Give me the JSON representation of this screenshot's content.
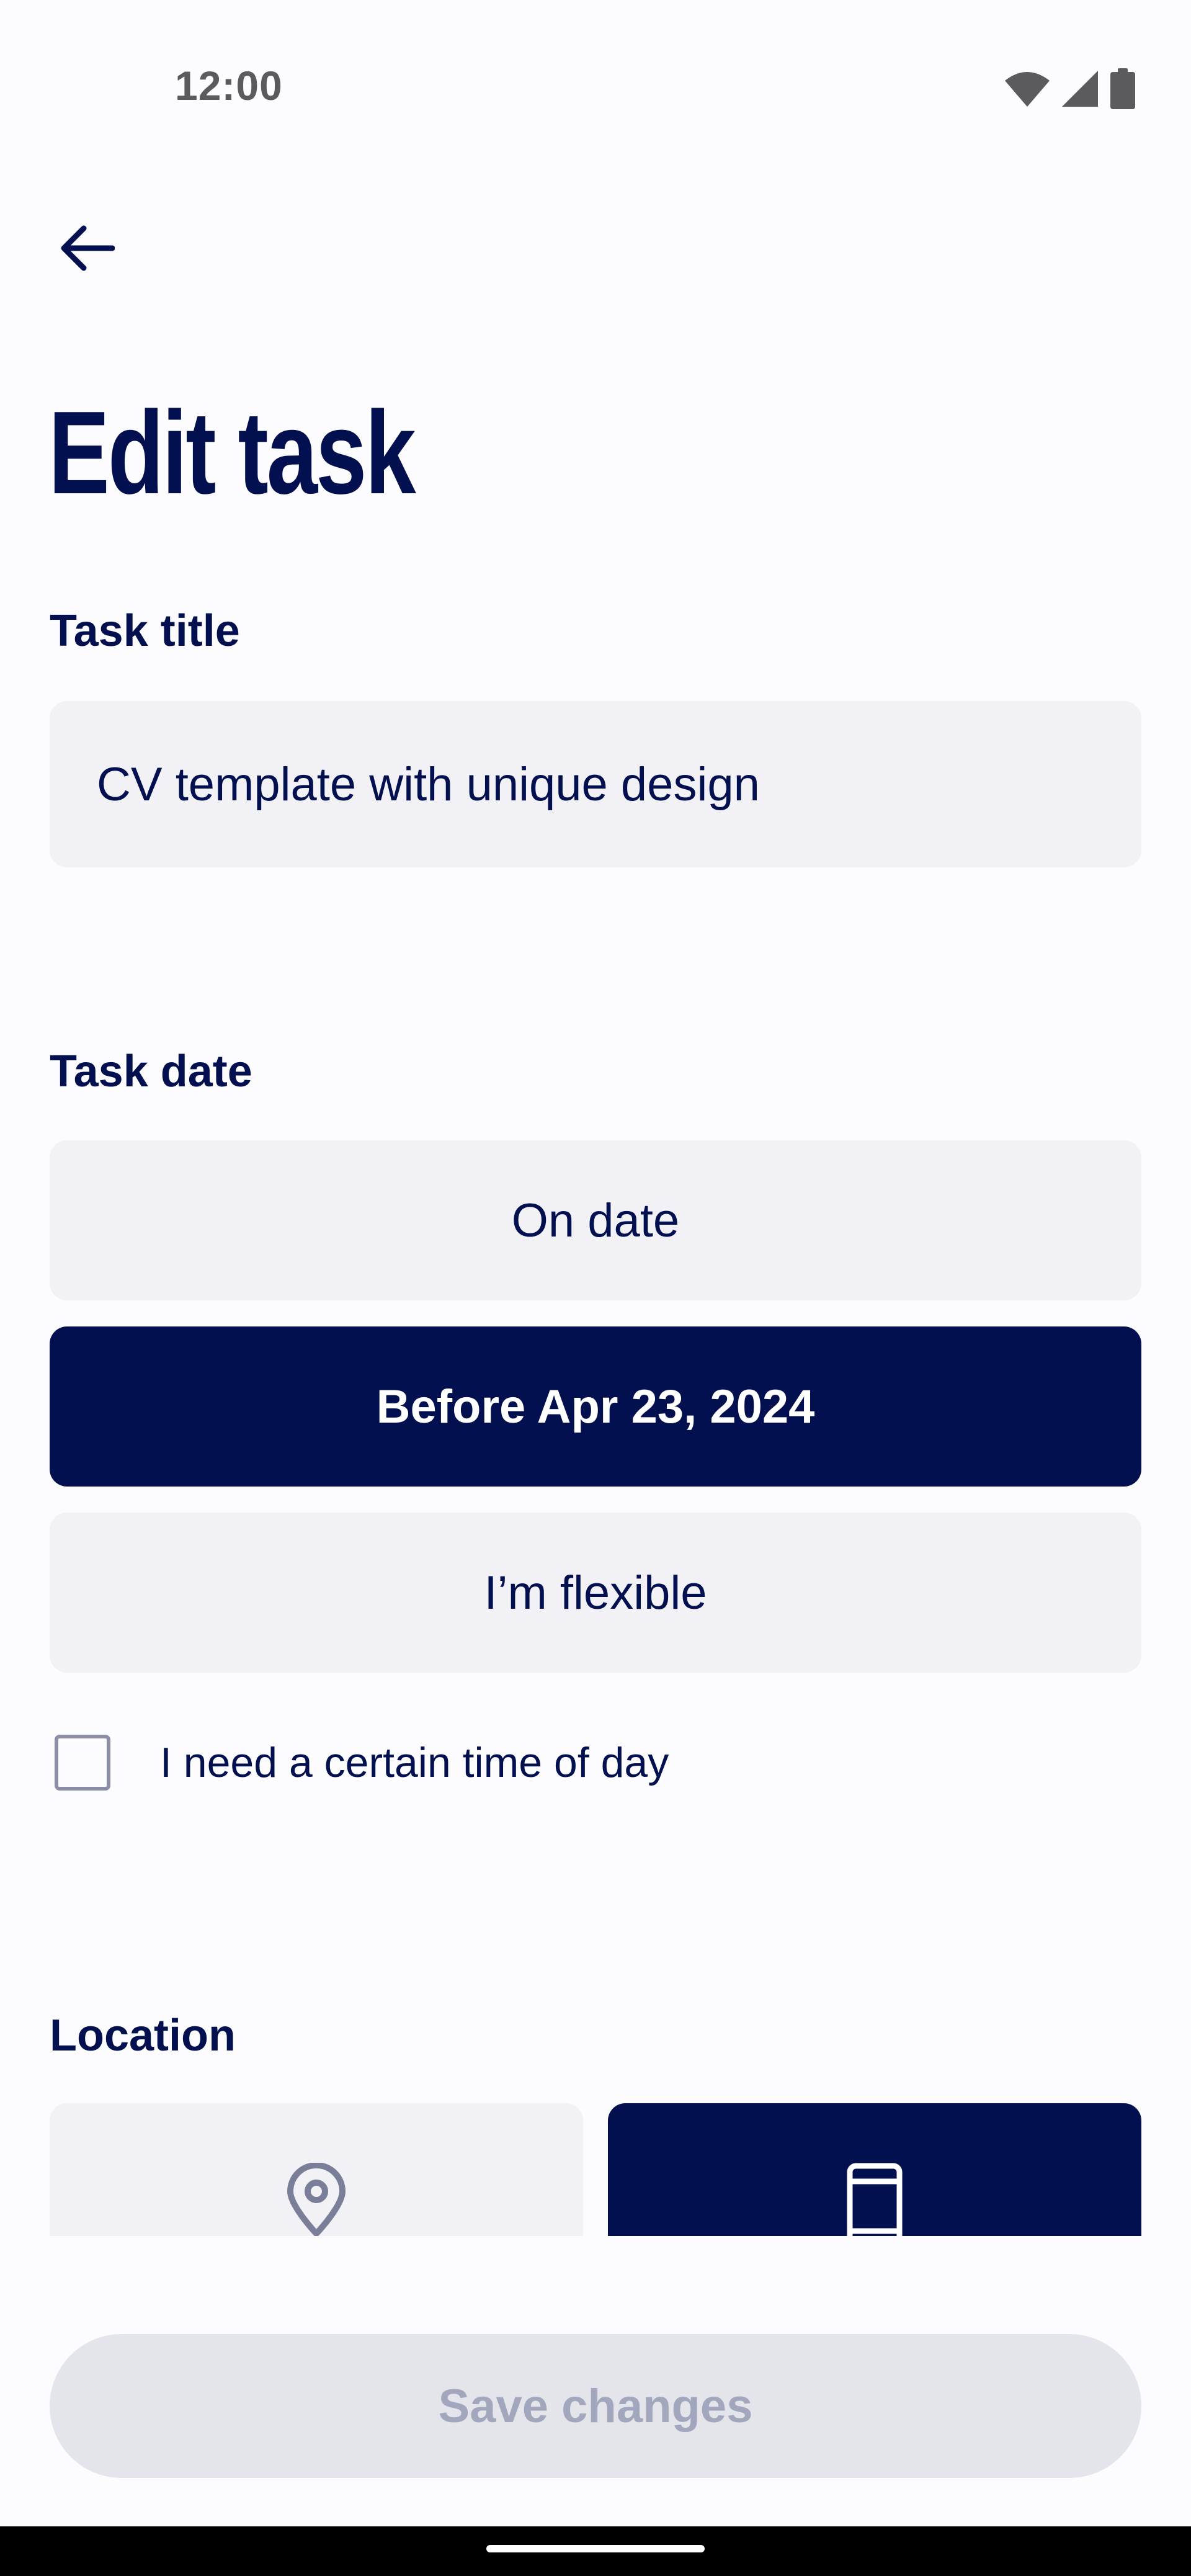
{
  "status_bar": {
    "time": "12:00",
    "icons": [
      "wifi-icon",
      "cell-signal-icon",
      "battery-icon"
    ]
  },
  "header": {
    "back_icon": "arrow-left-icon",
    "title": "Edit task"
  },
  "task_title": {
    "label": "Task title",
    "value": "CV template with unique design"
  },
  "task_date": {
    "label": "Task date",
    "options": [
      {
        "label": "On date",
        "selected": false
      },
      {
        "label": "Before Apr 23, 2024",
        "selected": true
      },
      {
        "label": "I’m flexible",
        "selected": false
      }
    ],
    "time_checkbox": {
      "label": "I need a certain time of day",
      "checked": false
    }
  },
  "location": {
    "label": "Location",
    "options": [
      {
        "icon": "map-pin-icon",
        "selected": false
      },
      {
        "icon": "smartphone-icon",
        "selected": true
      }
    ]
  },
  "footer": {
    "save_label": "Save changes",
    "enabled": false
  },
  "colors": {
    "primary": "#03104f",
    "field_background": "#f1f1f6",
    "disabled_button": "#e4e5eb",
    "disabled_text": "#a3a7bd"
  }
}
